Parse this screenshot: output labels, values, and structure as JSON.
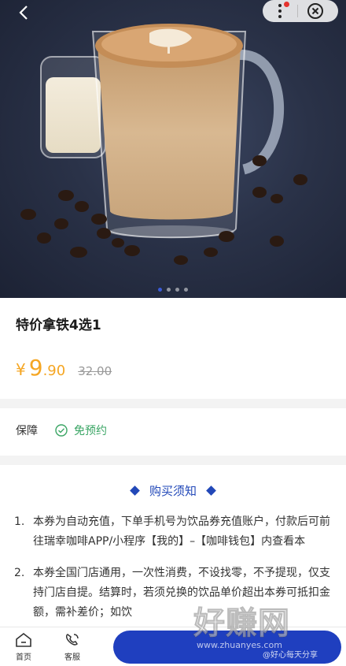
{
  "product": {
    "title": "特价拿铁4选1",
    "currency_symbol": "¥",
    "price_int": "9",
    "price_dec": ".90",
    "original_price": "32.00"
  },
  "guarantee": {
    "label": "保障",
    "value": "免预约"
  },
  "notice": {
    "heading": "购买须知",
    "items": [
      {
        "num": "1.",
        "text": "本券为自动充值，下单手机号为饮品券充值账户，付款后可前往瑞幸咖啡APP/小程序【我的】–【咖啡钱包】内查看本"
      },
      {
        "num": "2.",
        "text": "本券全国门店通用，一次性消费，不设找零，不予提现，仅支持门店自提。结算时，若须兑换的饮品单价超出本券可抵扣金额，需补差价；如饮"
      }
    ]
  },
  "tabs": [
    {
      "label": "首页",
      "icon": "home-icon"
    },
    {
      "label": "客服",
      "icon": "customer-service-icon"
    }
  ],
  "watermark": {
    "brand": "好赚网",
    "url": "www.zhuanyes.com",
    "user": "@好心每天分享"
  },
  "carousel": {
    "total": 4,
    "active": 0
  },
  "colors": {
    "accent": "#1f3fbf",
    "price": "#f5a623",
    "guarantee_green": "#3aa564"
  }
}
